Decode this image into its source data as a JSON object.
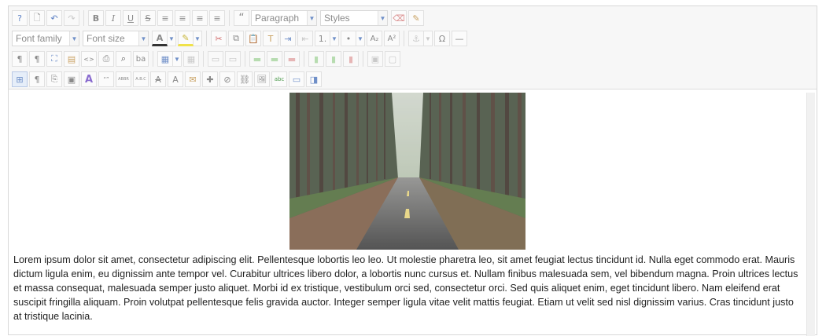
{
  "toolbar": {
    "row1": {
      "buttons": [
        {
          "name": "help-icon",
          "glyph": "?"
        },
        {
          "name": "new-document-icon",
          "glyph": "🗋"
        },
        {
          "name": "undo-icon",
          "glyph": "↶"
        },
        {
          "name": "redo-icon",
          "glyph": "↷"
        }
      ],
      "format_buttons": [
        {
          "name": "bold-icon",
          "glyph": "B"
        },
        {
          "name": "italic-icon",
          "glyph": "I"
        },
        {
          "name": "underline-icon",
          "glyph": "U"
        },
        {
          "name": "strikethrough-icon",
          "glyph": "S"
        },
        {
          "name": "align-justify-icon",
          "glyph": "≡"
        },
        {
          "name": "align-center-icon",
          "glyph": "≡"
        },
        {
          "name": "align-left-icon",
          "glyph": "≡"
        },
        {
          "name": "align-right-icon",
          "glyph": "≡"
        }
      ],
      "blockquote_glyph": "“",
      "block_format": "Paragraph",
      "styles": "Styles",
      "eraser_glyph": "⌫",
      "clear_glyph": "✎"
    },
    "row2": {
      "font_family": "Font family",
      "font_size": "Font size",
      "text_color_glyph": "A",
      "highlight_glyph": "✎",
      "buttons": [
        {
          "name": "cut-icon",
          "glyph": "✂"
        },
        {
          "name": "copy-icon",
          "glyph": "⧉"
        },
        {
          "name": "paste-icon",
          "glyph": "📋"
        },
        {
          "name": "paste-text-icon",
          "glyph": "T"
        },
        {
          "name": "indent-icon",
          "glyph": "⇥"
        },
        {
          "name": "outdent-icon",
          "glyph": "⇤"
        }
      ],
      "numbered_list_glyph": "1.",
      "bullet_list_glyph": "•",
      "subscript_glyph": "A₂",
      "superscript_glyph": "A²",
      "anchor_glyph": "⚓",
      "special_char_glyph": "Ω",
      "hr_glyph": "—"
    },
    "row3": {
      "buttons": [
        {
          "name": "ltr-icon",
          "glyph": "¶"
        },
        {
          "name": "rtl-icon",
          "glyph": "¶"
        },
        {
          "name": "fullscreen-icon",
          "glyph": "⛶"
        },
        {
          "name": "template-icon",
          "glyph": "▤"
        },
        {
          "name": "source-code-icon",
          "glyph": "<>"
        },
        {
          "name": "print-icon",
          "glyph": "⎙"
        },
        {
          "name": "find-icon",
          "glyph": "⌕"
        },
        {
          "name": "replace-icon",
          "glyph": "ba"
        }
      ],
      "table_glyph": "▦",
      "table_buttons": [
        {
          "name": "table-delete-icon",
          "glyph": "▦"
        },
        {
          "name": "table-row-props-icon",
          "glyph": "▭"
        },
        {
          "name": "table-cell-props-icon",
          "glyph": "▭"
        },
        {
          "name": "insert-row-before-icon",
          "glyph": "▬"
        },
        {
          "name": "insert-row-after-icon",
          "glyph": "▬"
        },
        {
          "name": "delete-row-icon",
          "glyph": "▬"
        },
        {
          "name": "insert-col-before-icon",
          "glyph": "▮"
        },
        {
          "name": "insert-col-after-icon",
          "glyph": "▮"
        },
        {
          "name": "delete-col-icon",
          "glyph": "▮"
        },
        {
          "name": "merge-cells-icon",
          "glyph": "▣"
        },
        {
          "name": "split-cells-icon",
          "glyph": "▢"
        }
      ]
    },
    "row4": {
      "buttons": [
        {
          "name": "visual-aid-icon",
          "glyph": "⊞",
          "active": true
        },
        {
          "name": "show-blocks-icon",
          "glyph": "¶"
        },
        {
          "name": "page-break-icon",
          "glyph": "⎘"
        },
        {
          "name": "image-edit-icon",
          "glyph": "▣"
        },
        {
          "name": "font-style-icon",
          "glyph": "A"
        },
        {
          "name": "quote-tag-icon",
          "glyph": "“”"
        },
        {
          "name": "abbr-icon",
          "glyph": "ABBR"
        },
        {
          "name": "acronym-icon",
          "glyph": "A.B.C"
        },
        {
          "name": "del-icon",
          "glyph": "A"
        },
        {
          "name": "ins-icon",
          "glyph": "A"
        },
        {
          "name": "attributes-icon",
          "glyph": "✉"
        },
        {
          "name": "puzzle-icon",
          "glyph": "✚"
        },
        {
          "name": "unlink-icon",
          "glyph": "⊘"
        },
        {
          "name": "link-icon",
          "glyph": "⛓"
        },
        {
          "name": "image-icon",
          "glyph": "🖼"
        },
        {
          "name": "spellcheck-icon",
          "glyph": "abc"
        },
        {
          "name": "media-icon",
          "glyph": "▭"
        },
        {
          "name": "preview-icon",
          "glyph": "◨"
        }
      ]
    }
  },
  "content": {
    "photo_alt": "Forest road",
    "paragraph": "Lorem ipsum dolor sit amet, consectetur adipiscing elit. Pellentesque lobortis leo leo. Ut molestie pharetra leo, sit amet feugiat lectus tincidunt id. Nulla eget commodo erat. Mauris dictum ligula enim, eu dignissim ante tempor vel. Curabitur ultrices libero dolor, a lobortis nunc cursus et. Nullam finibus malesuada sem, vel bibendum magna. Proin ultrices lectus et massa consequat, malesuada semper justo aliquet. Morbi id ex tristique, vestibulum orci sed, consectetur orci. Sed quis aliquet enim, eget tincidunt libero. Nam eleifend erat suscipit fringilla aliquam. Proin volutpat pellentesque felis gravida auctor. Integer semper ligula vitae velit mattis feugiat. Etiam ut velit sed nisl dignissim varius. Cras tincidunt justo at tristique lacinia."
  }
}
